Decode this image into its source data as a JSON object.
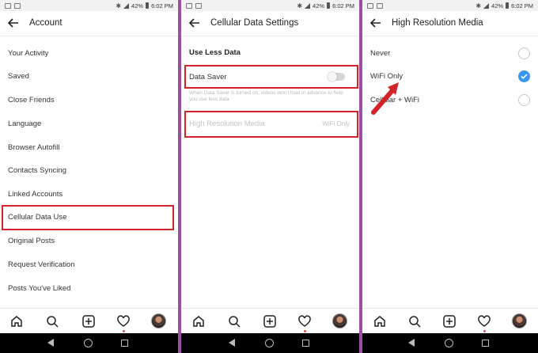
{
  "status": {
    "battery": "42%",
    "time": "6:02 PM"
  },
  "panel1": {
    "title": "Account",
    "items": [
      "Your Activity",
      "Saved",
      "Close Friends",
      "Language",
      "Browser Autofill",
      "Contacts Syncing",
      "Linked Accounts",
      "Cellular Data Use",
      "Original Posts",
      "Request Verification",
      "Posts You've Liked"
    ]
  },
  "panel2": {
    "title": "Cellular Data Settings",
    "section": "Use Less Data",
    "data_saver_label": "Data Saver",
    "helper": "When Data Saver is turned on, videos won't load in advance to help you use less data",
    "hires_label": "High Resolution Media",
    "hires_value": "WiFi Only"
  },
  "panel3": {
    "title": "High Resolution Media",
    "options": [
      "Never",
      "WiFi Only",
      "Cellular + WiFi"
    ],
    "selected": "WiFi Only"
  },
  "colors": {
    "highlight": "#d2232a",
    "accent": "#3897f0",
    "divider": "#9b4f9e"
  }
}
